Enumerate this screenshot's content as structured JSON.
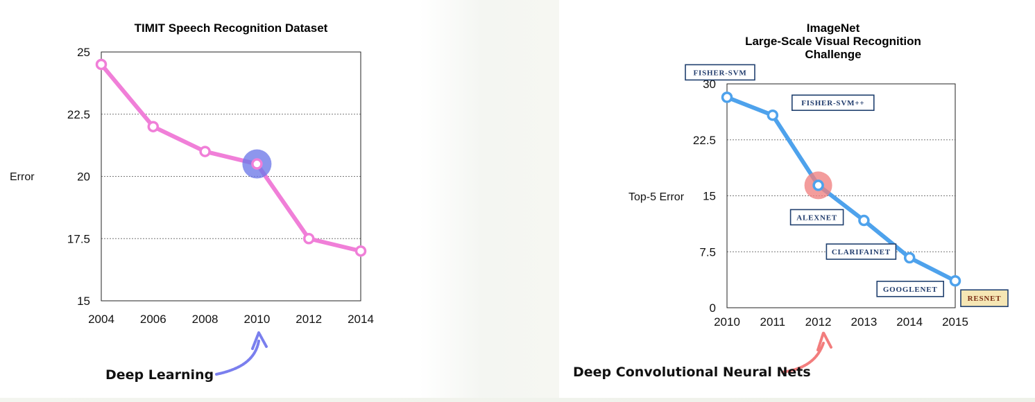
{
  "chart_data": [
    {
      "type": "line",
      "title": [
        "TIMIT Speech Recognition Dataset"
      ],
      "ylabel": "Error",
      "xlabel": "",
      "x": [
        2004,
        2006,
        2008,
        2010,
        2012,
        2014
      ],
      "xticks": [
        "2004",
        "2006",
        "2008",
        "2010",
        "2012",
        "2014"
      ],
      "yticks": [
        "25",
        "22.5",
        "20",
        "17.5",
        "15"
      ],
      "ylim": [
        15,
        25
      ],
      "xlim": [
        2004,
        2014
      ],
      "grid": true,
      "series": [
        {
          "values": [
            24.5,
            22.0,
            21.0,
            20.5,
            17.5,
            17.0
          ],
          "color": "#f07fd8"
        }
      ],
      "highlight": {
        "x": 2010,
        "y": 20.5,
        "color": "#6d79e8"
      },
      "annotation": {
        "label": "Deep Learning",
        "arrow_color": "#7a7fee"
      }
    },
    {
      "type": "line",
      "title": [
        "ImageNet",
        "Large-Scale Visual Recognition",
        "Challenge"
      ],
      "ylabel": "Top-5 Error",
      "xlabel": "",
      "x": [
        2010,
        2011,
        2012,
        2013,
        2014,
        2015
      ],
      "xticks": [
        "2010",
        "2011",
        "2012",
        "2013",
        "2014",
        "2015"
      ],
      "yticks": [
        "30",
        "22.5",
        "15",
        "7.5",
        "0"
      ],
      "ylim": [
        0,
        30
      ],
      "xlim": [
        2010,
        2015
      ],
      "grid": true,
      "series": [
        {
          "values": [
            28.2,
            25.8,
            16.4,
            11.7,
            6.7,
            3.6
          ],
          "color": "#4ea2ec"
        }
      ],
      "highlight": {
        "x": 2012,
        "y": 16.4,
        "color": "#f08080"
      },
      "annotation": {
        "label": "Deep Convolutional Neural Nets",
        "arrow_color": "#f27d7d"
      },
      "model_labels": [
        {
          "text": "FISHER-SVM",
          "x": 2010
        },
        {
          "text": "FISHER-SVM++",
          "x": 2011
        },
        {
          "text": "ALEXNET",
          "x": 2012
        },
        {
          "text": "CLARIFAINET",
          "x": 2013
        },
        {
          "text": "GOOGLENET",
          "x": 2014
        },
        {
          "text": "RESNET",
          "x": 2015,
          "best": true
        }
      ]
    }
  ]
}
